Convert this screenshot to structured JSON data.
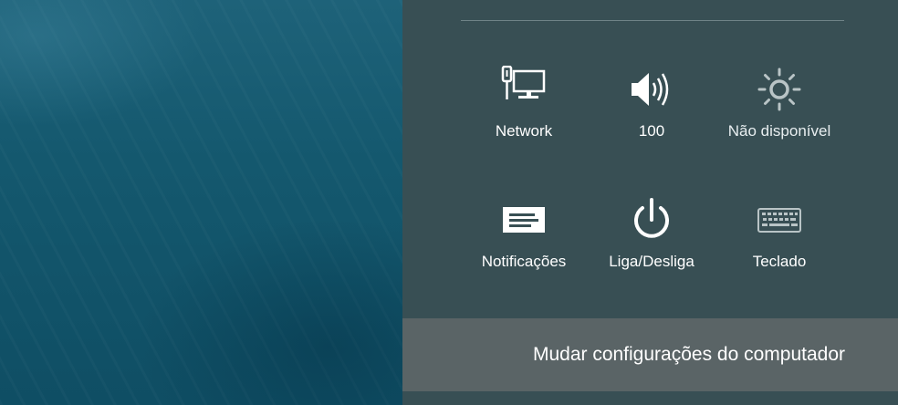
{
  "quick_settings": [
    {
      "id": "network",
      "label": "Network",
      "icon": "network-monitor-icon",
      "enabled": true
    },
    {
      "id": "volume",
      "label": "100",
      "icon": "speaker-icon",
      "enabled": true
    },
    {
      "id": "brightness",
      "label": "Não disponível",
      "icon": "brightness-icon",
      "enabled": false
    },
    {
      "id": "notifications",
      "label": "Notificações",
      "icon": "notifications-icon",
      "enabled": true
    },
    {
      "id": "power",
      "label": "Liga/Desliga",
      "icon": "power-icon",
      "enabled": true
    },
    {
      "id": "keyboard",
      "label": "Teclado",
      "icon": "keyboard-icon",
      "enabled": true
    }
  ],
  "footer": {
    "change_settings_label": "Mudar configurações do computador"
  },
  "colors": {
    "panel_bg": "#384f54",
    "footer_bg": "#5a6466",
    "icon_active": "#ffffff",
    "icon_dim": "#b9c4c6",
    "desktop_bg": "#16596f"
  }
}
